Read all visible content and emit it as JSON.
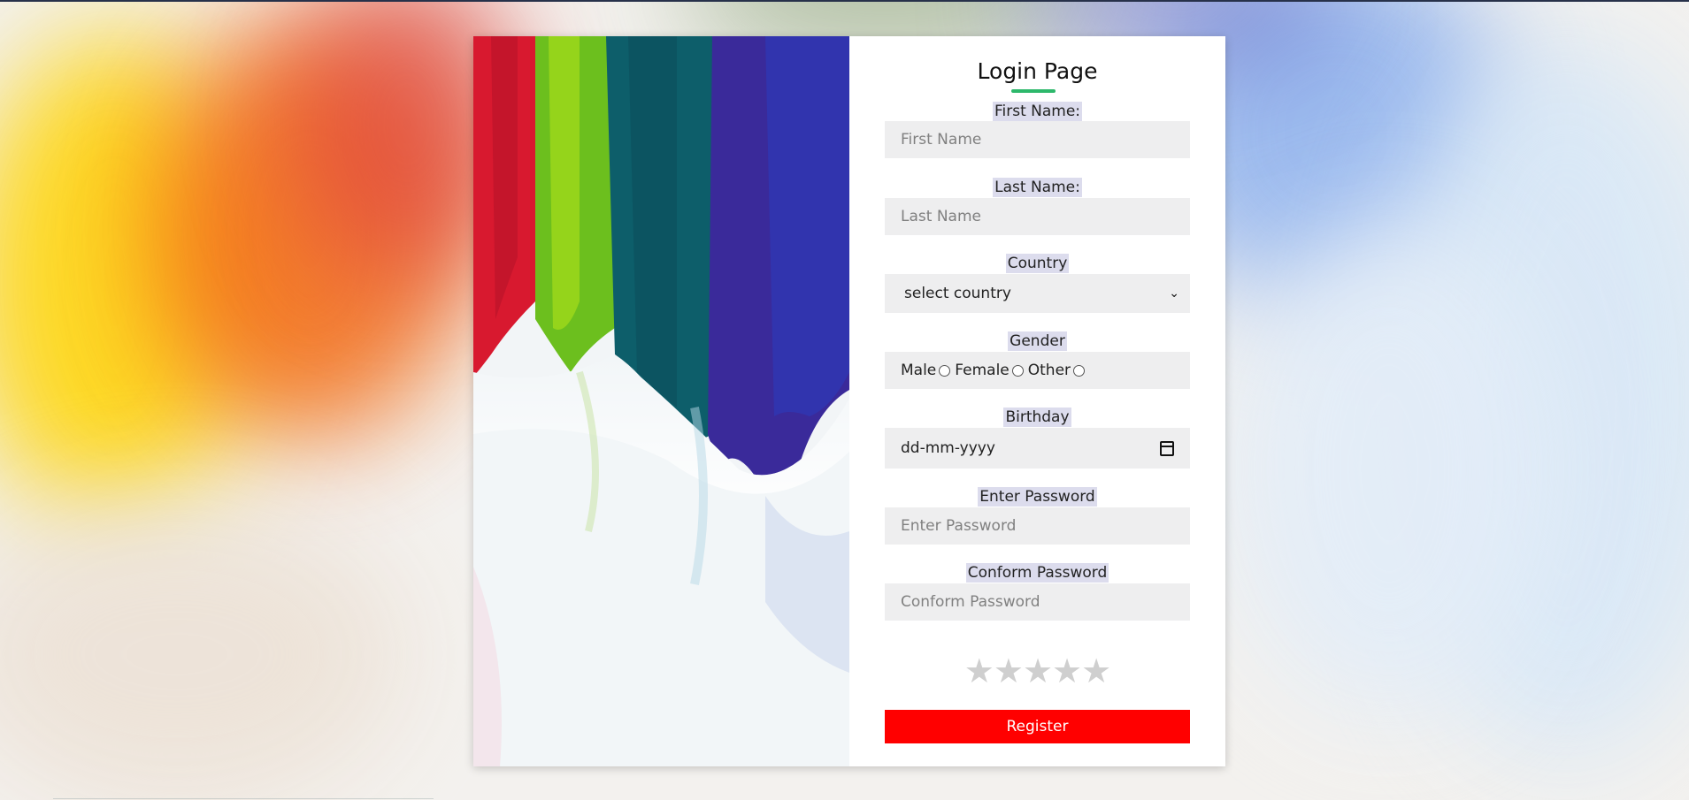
{
  "page": {
    "title": "Login Page",
    "accent_color": "#2db86b",
    "register_color": "#ff0000"
  },
  "form": {
    "first_name": {
      "label": "First Name:",
      "placeholder": "First Name"
    },
    "last_name": {
      "label": "Last Name:",
      "placeholder": "Last Name"
    },
    "country": {
      "label": "Country",
      "selected": "select country"
    },
    "gender": {
      "label": "Gender",
      "options": [
        "Male",
        "Female",
        "Other"
      ]
    },
    "birthday": {
      "label": "Birthday",
      "value": "dd-mm-yyyy"
    },
    "password": {
      "label": "Enter Password",
      "placeholder": "Enter Password"
    },
    "confirm_password": {
      "label": "Conform Password",
      "placeholder": "Conform Password"
    },
    "rating": {
      "stars_total": 5,
      "stars_filled": 0
    },
    "submit_label": "Register"
  }
}
